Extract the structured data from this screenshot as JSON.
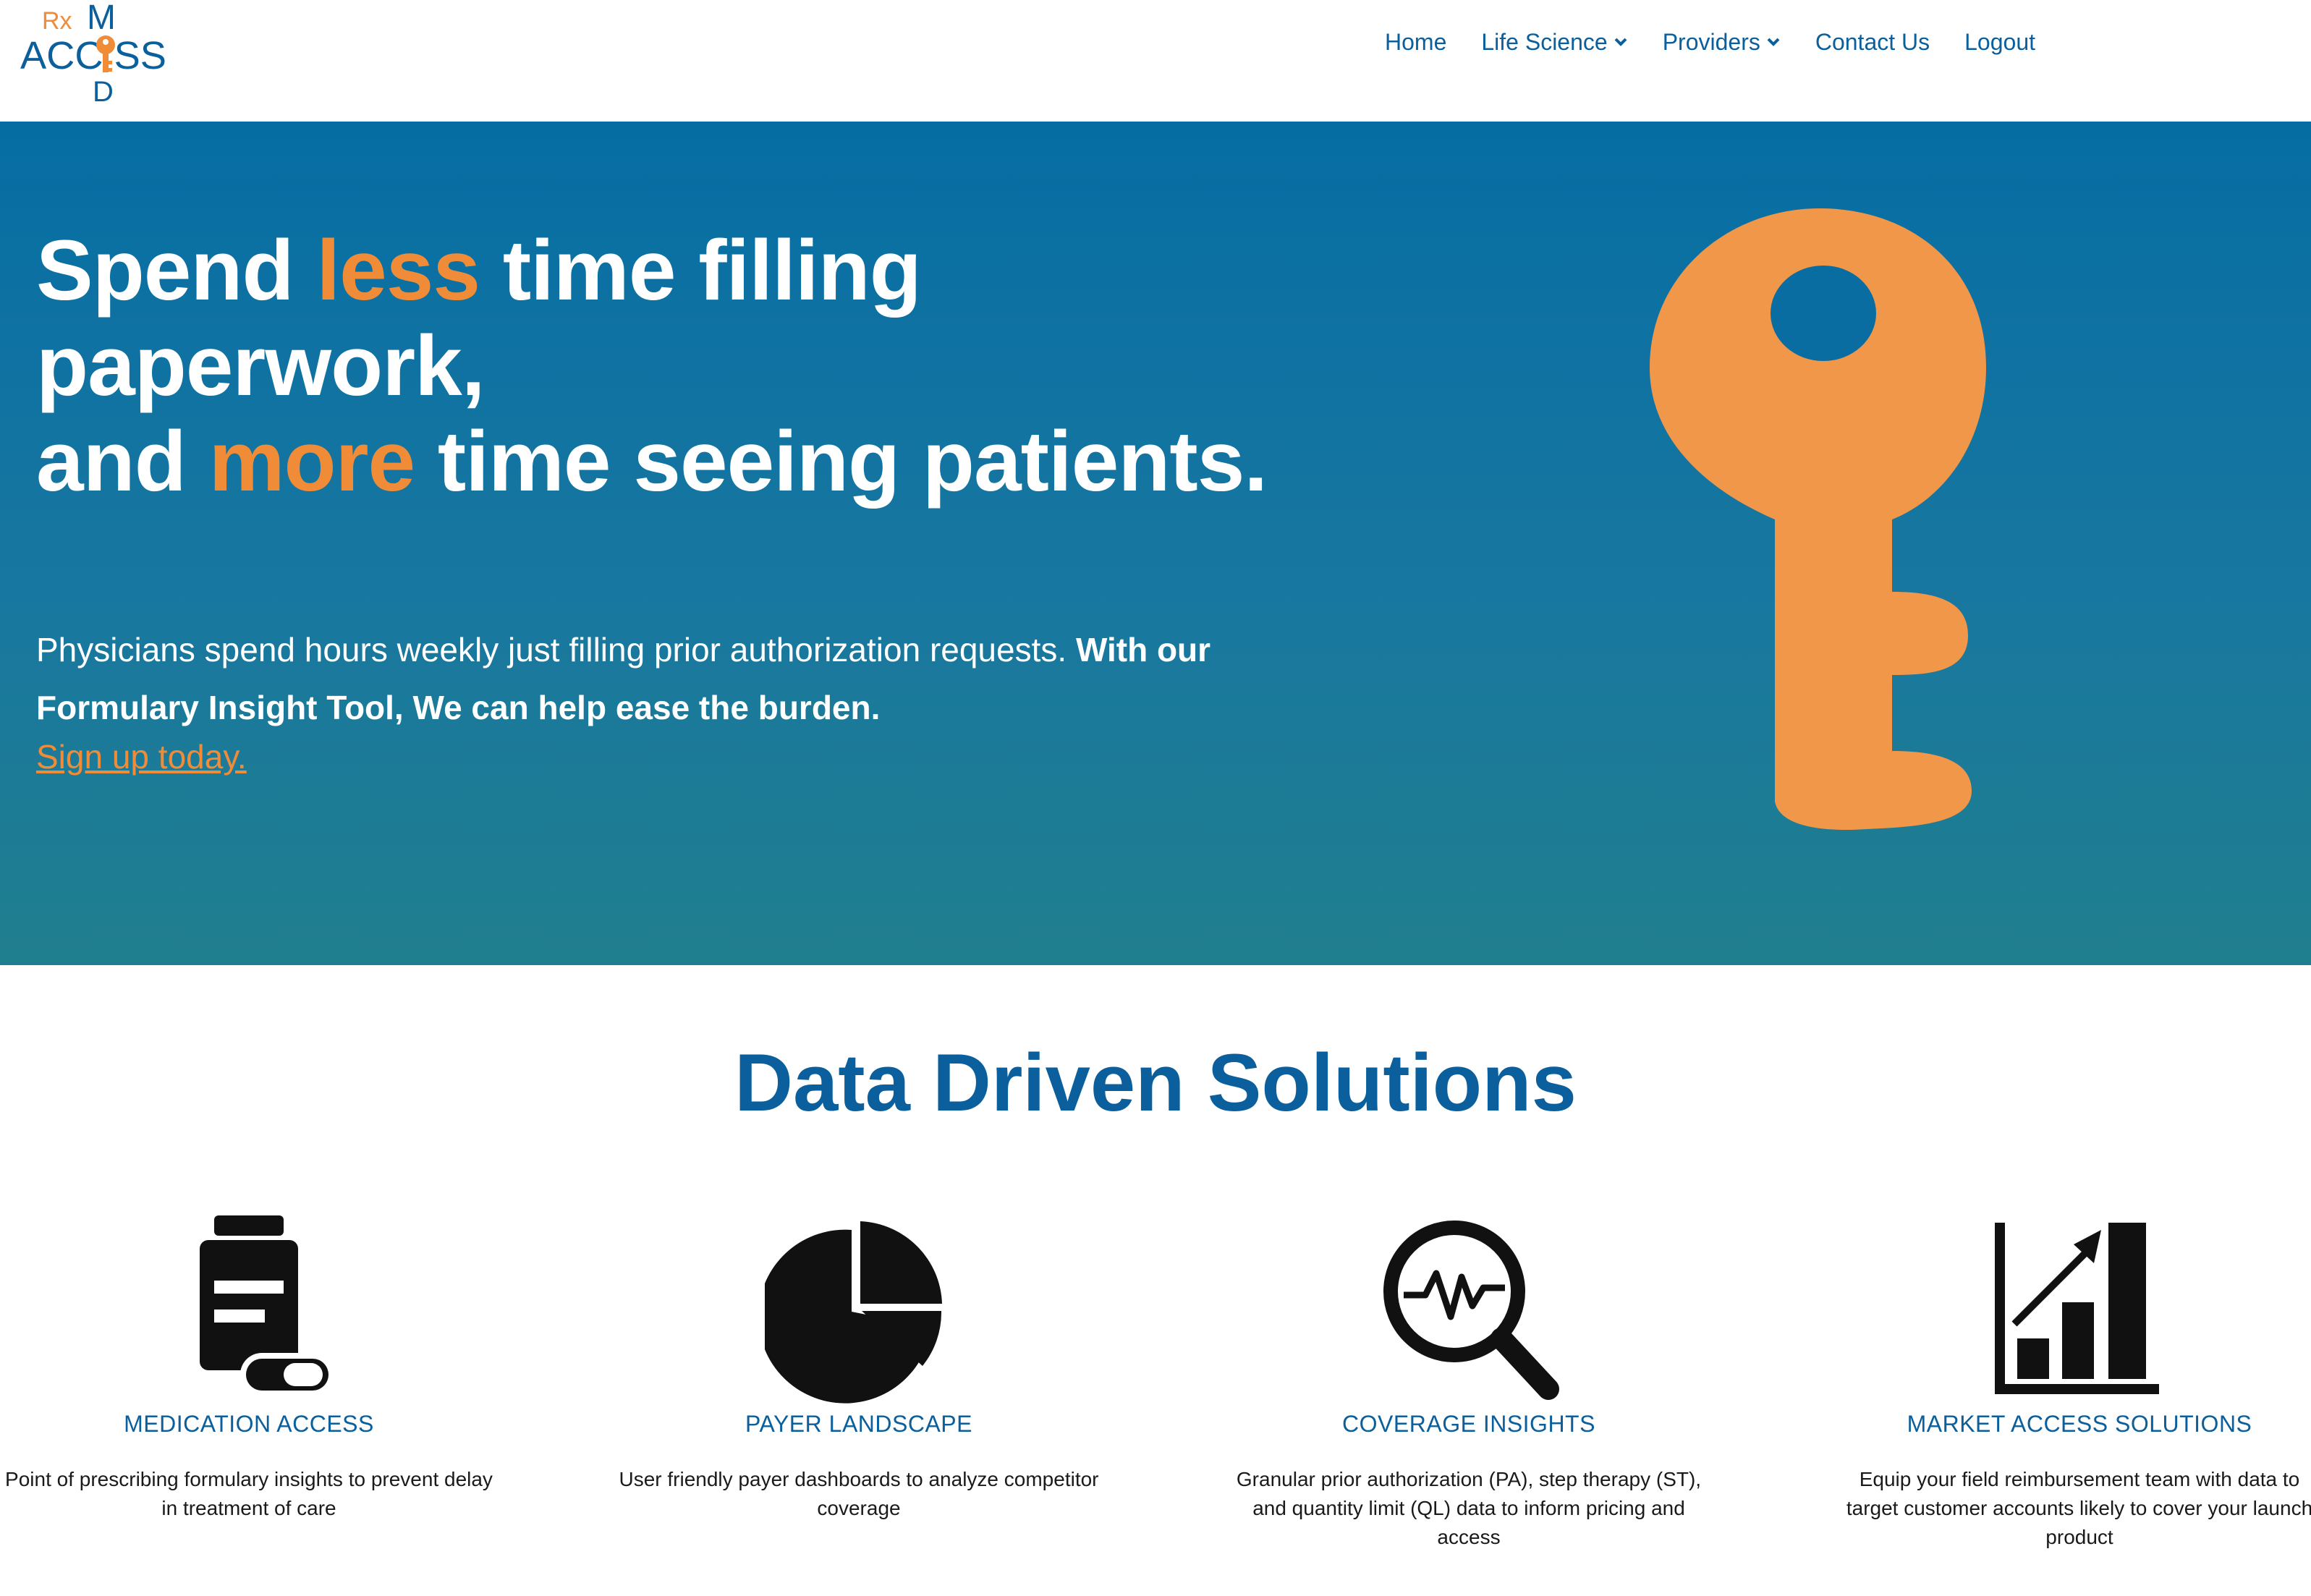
{
  "brand": {
    "logo_letters": "RxMACCESSD",
    "logo_icon": "key-logo-icon",
    "colors": {
      "primary": "#0a5f9c",
      "accent": "#f08c38",
      "hero_top": "#066da3",
      "hero_bottom": "#207f8e"
    }
  },
  "nav": {
    "home": "Home",
    "life_science": "Life Science",
    "providers": "Providers",
    "contact": "Contact Us",
    "logout": "Logout"
  },
  "hero": {
    "title_part1": "Spend ",
    "title_accent1": "less",
    "title_part2": " time filling paperwork,",
    "title_part3": "and ",
    "title_accent2": "more",
    "title_part4": " time seeing patients.",
    "body_regular": "Physicians spend hours weekly just filling prior authorization requests. ",
    "body_bold": "With our Formulary Insight Tool, We can help ease the burden.",
    "link": "Sign up today.",
    "illustration": "key-icon"
  },
  "solutions": {
    "title": "Data Driven Solutions",
    "cards": [
      {
        "icon": "medicine-bottle-icon",
        "title": "MEDICATION ACCESS",
        "desc": "Point of prescribing formulary insights to prevent delay in treatment of care"
      },
      {
        "icon": "pie-chart-icon",
        "title": "PAYER LANDSCAPE",
        "desc": "User friendly payer dashboards to analyze competitor coverage"
      },
      {
        "icon": "magnifier-pulse-icon",
        "title": "COVERAGE INSIGHTS",
        "desc": "Granular prior authorization (PA), step therapy (ST), and quantity limit (QL) data to inform pricing and access"
      },
      {
        "icon": "bar-growth-icon",
        "title": "MARKET ACCESS SOLUTIONS",
        "desc": "Equip your field reimbursement team with data to target customer accounts likely to cover your launch product"
      }
    ]
  }
}
